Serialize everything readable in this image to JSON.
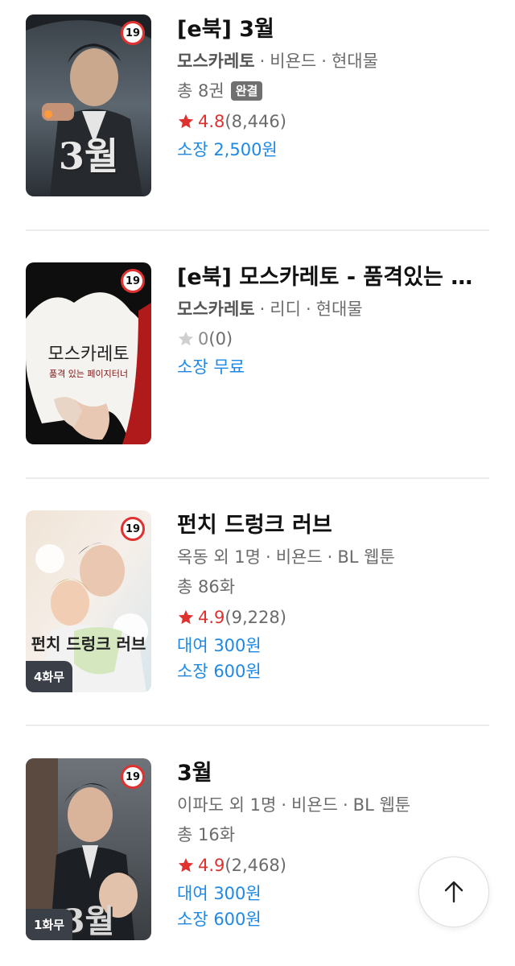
{
  "books": [
    {
      "title": "[e북] 3월",
      "authors": "모스카레토",
      "authors_bold": true,
      "publisher": "비욘드",
      "genre": "현대물",
      "count": "총 8권",
      "complete_tag": "완결",
      "rating": "4.8",
      "reviews": "(8,446)",
      "prices": [
        "소장 2,500원"
      ],
      "age": "19",
      "free_badge": "",
      "cover_text": "3월",
      "icon": "star-icon"
    },
    {
      "title": "[e북] 모스카레토 - 품격있는 페이지터너",
      "authors": "모스카레토",
      "authors_bold": true,
      "publisher": "리디",
      "genre": "현대물",
      "count": "",
      "complete_tag": "",
      "rating": "0",
      "reviews": "(0)",
      "prices": [
        "소장 무료"
      ],
      "age": "19",
      "free_badge": "",
      "cover_text": "모스카레토",
      "cover_subtext": "품격 있는 페이지터너",
      "icon": "star-outline-icon"
    },
    {
      "title": "펀치 드렁크 러브",
      "authors": "옥동 외 1명",
      "authors_bold": false,
      "publisher": "비욘드",
      "genre": "BL 웹툰",
      "count": "총 86화",
      "complete_tag": "",
      "rating": "4.9",
      "reviews": "(9,228)",
      "prices": [
        "대여 300원",
        "소장 600원"
      ],
      "age": "19",
      "free_badge": "4화무",
      "cover_text": "펀치 드렁크 러브",
      "icon": "star-icon"
    },
    {
      "title": "3월",
      "authors": "이파도 외 1명",
      "authors_bold": false,
      "publisher": "비욘드",
      "genre": "BL 웹툰",
      "count": "총 16화",
      "complete_tag": "",
      "rating": "4.9",
      "reviews": "(2,468)",
      "prices": [
        "대여 300원",
        "소장 600원"
      ],
      "age": "19",
      "free_badge": "1화무",
      "cover_text": "3월",
      "icon": "star-icon"
    }
  ],
  "ui": {
    "separator": "·",
    "scroll_top_icon": "arrow-up-icon"
  },
  "colors": {
    "rating_red": "#e03131",
    "price_blue": "#1e88e5",
    "meta_gray": "#6b6b6b",
    "badge_dark": "#3b3f48"
  }
}
